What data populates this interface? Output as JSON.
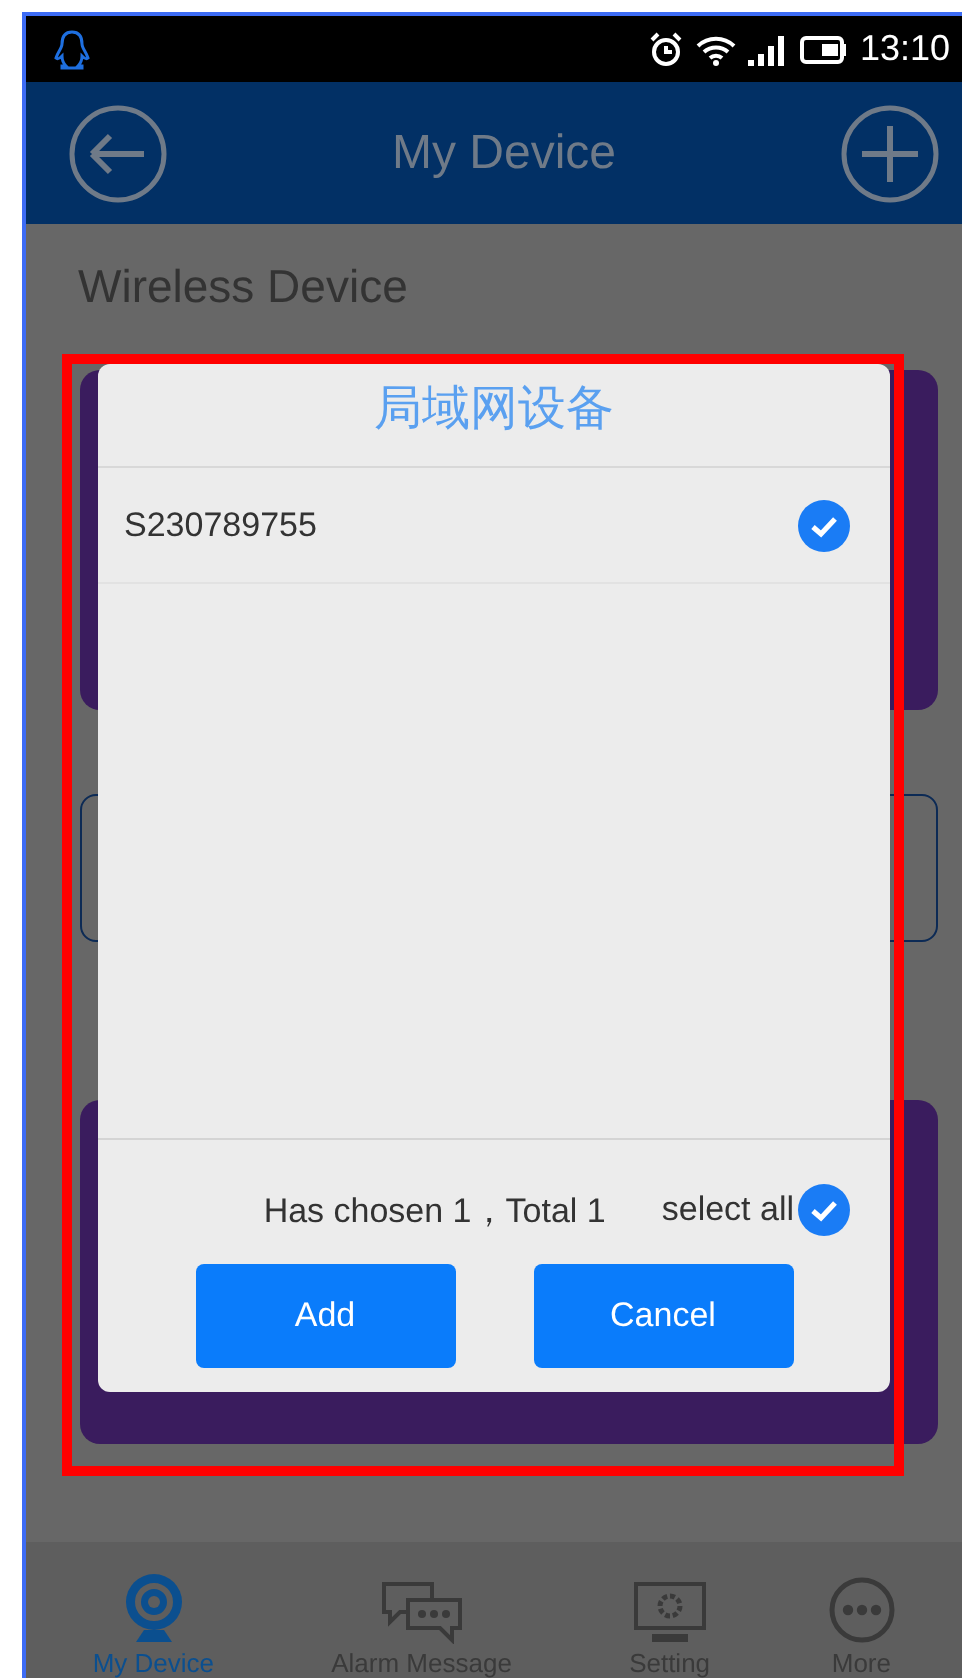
{
  "status_bar": {
    "time": "13:10"
  },
  "app_bar": {
    "title": "My Device"
  },
  "background": {
    "section_title": "Wireless Device"
  },
  "dialog": {
    "title": "局域网设备",
    "devices": [
      {
        "name": "S230789755",
        "checked": true
      }
    ],
    "summary": "Has chosen 1，Total 1",
    "select_all": {
      "label": "select all",
      "checked": true
    },
    "buttons": [
      "Add",
      "Cancel"
    ]
  },
  "tabs": [
    {
      "label": "My Device",
      "selected": true
    },
    {
      "label": "Alarm Message",
      "selected": false
    },
    {
      "label": "Setting",
      "selected": false
    },
    {
      "label": "More",
      "selected": false
    }
  ]
}
